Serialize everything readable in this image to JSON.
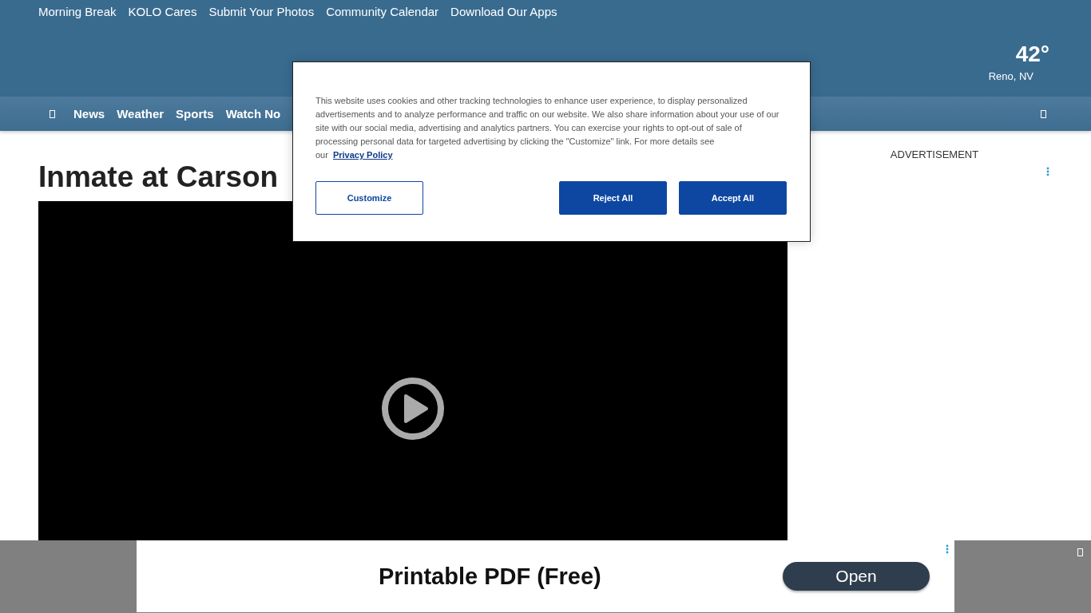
{
  "top_links": [
    "Morning Break",
    "KOLO Cares",
    "Submit Your Photos",
    "Community Calendar",
    "Download Our Apps"
  ],
  "weather": {
    "temperature": "42°",
    "location": "Reno, NV"
  },
  "nav": {
    "items": [
      "News",
      "Weather",
      "Sports",
      "Watch No"
    ]
  },
  "article": {
    "headline": "Inmate at Carson"
  },
  "sidebar": {
    "ad_label": "ADVERTISEMENT"
  },
  "cookie_banner": {
    "text": "This website uses cookies and other tracking technologies to enhance user experience, to display personalized advertisements and to analyze performance and traffic on our website. We also share information about your use of our site with our social media, advertising and analytics partners. You can exercise your rights to opt-out of sale of processing personal data for targeted advertising by clicking the \"Customize\" link. For more details see our",
    "link": "Privacy Policy",
    "buttons": [
      {
        "label": "Customize",
        "kind": "outline"
      },
      {
        "label": "Reject All",
        "kind": "solid"
      },
      {
        "label": "Accept All",
        "kind": "solid"
      }
    ]
  },
  "bottom_ad": {
    "title": "Printable PDF (Free)",
    "button": "Open"
  }
}
